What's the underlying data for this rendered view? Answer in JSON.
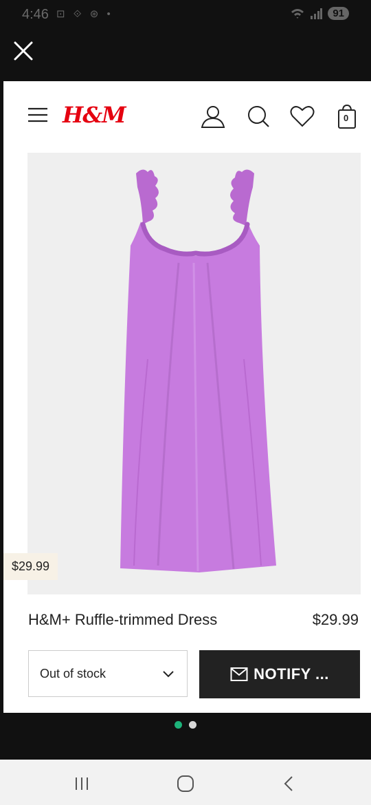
{
  "status_bar": {
    "time": "4:46",
    "left_icons": "⊡ ⟐ ⊛ •",
    "battery": "91"
  },
  "header": {
    "brand": "H&M",
    "bag_count": "0"
  },
  "product": {
    "image_price_tag": "$29.99",
    "name": "H&M+ Ruffle-trimmed Dress",
    "price": "$29.99",
    "size_select_value": "Out of stock",
    "notify_label": "NOTIFY ...",
    "dress_color": "#c77bdf"
  },
  "carousel": {
    "dots": [
      "active",
      "inactive"
    ],
    "active_color": "#1db37a",
    "inactive_color": "#d8d8d8"
  },
  "system_nav": {
    "recents_icon": "recents-icon",
    "home_icon": "home-icon",
    "back_icon": "back-icon"
  }
}
